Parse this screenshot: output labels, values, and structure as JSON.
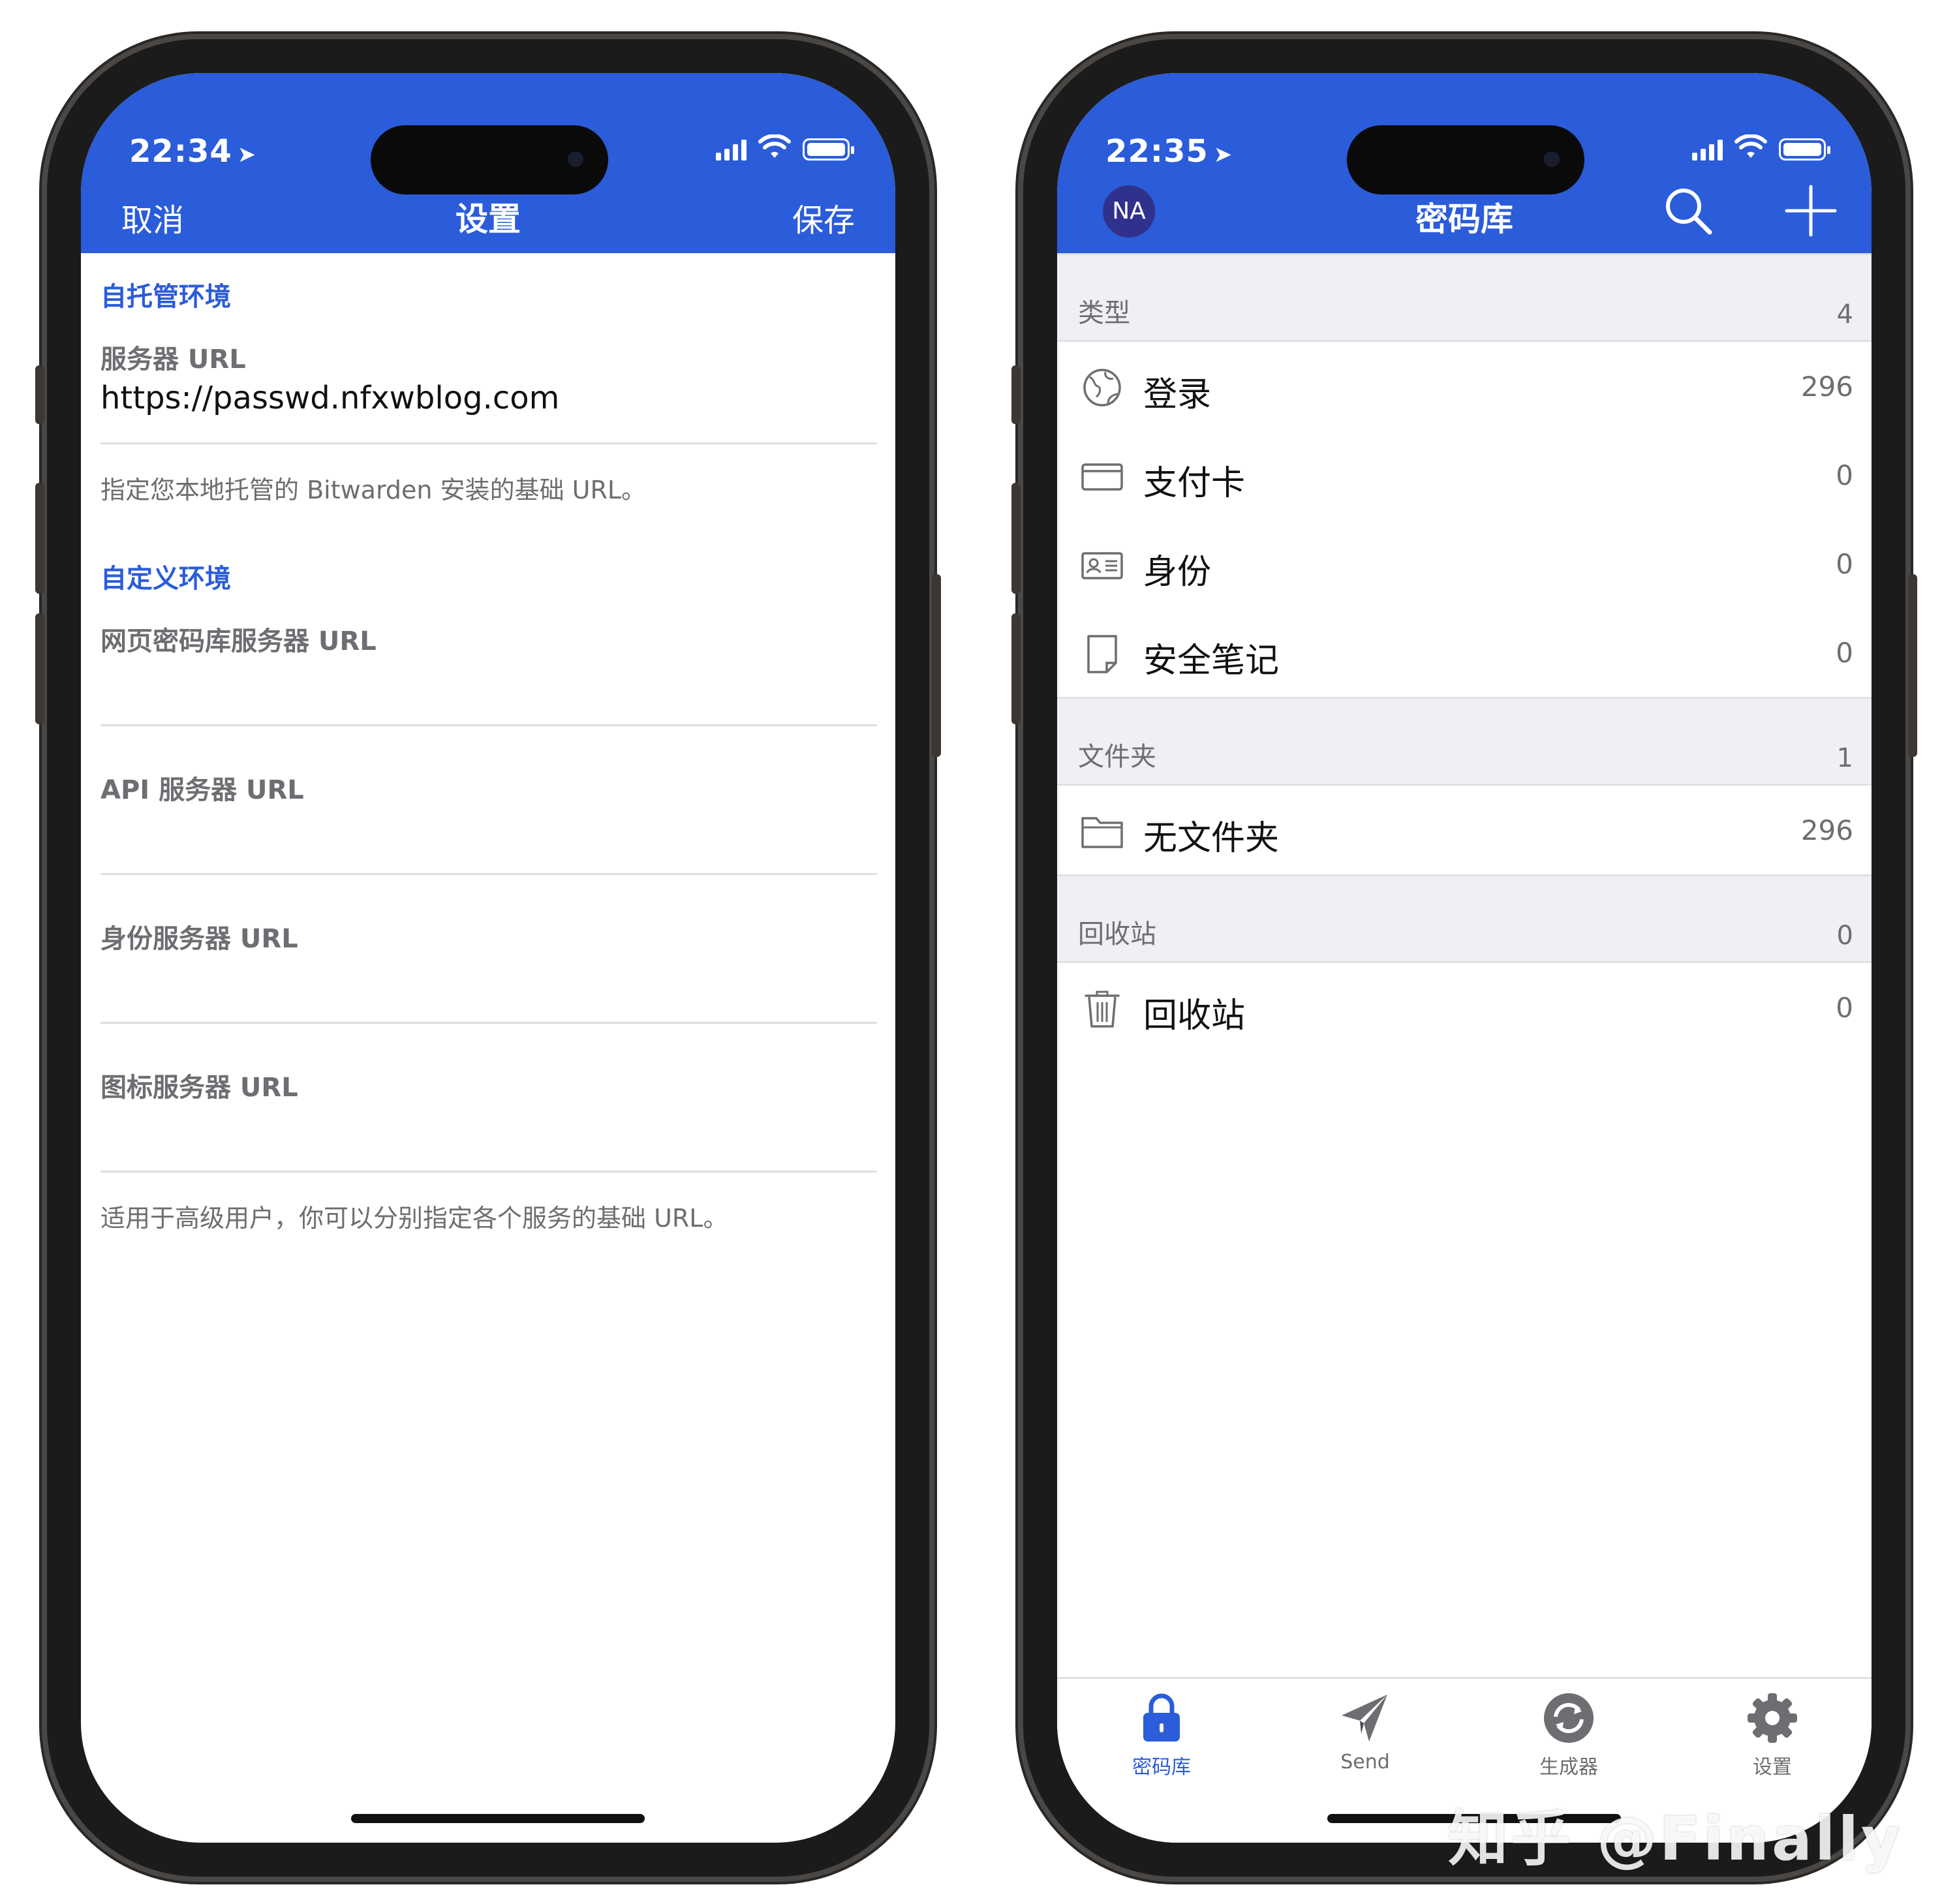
{
  "left_phone": {
    "status": {
      "time": "22:34",
      "location_arrow": "location-arrow-icon"
    },
    "nav": {
      "cancel": "取消",
      "title": "设置",
      "save": "保存"
    },
    "self_hosted": {
      "section": "自托管环境",
      "server_url_label": "服务器 URL",
      "server_url_value": "https://passwd.nfxwblog.com",
      "hint": "指定您本地托管的 Bitwarden 安装的基础 URL。"
    },
    "custom": {
      "section": "自定义环境",
      "web_vault_label": "网页密码库服务器 URL",
      "api_label": "API 服务器 URL",
      "identity_label": "身份服务器 URL",
      "icons_label": "图标服务器 URL",
      "hint": "适用于高级用户，你可以分别指定各个服务的基础 URL。"
    }
  },
  "right_phone": {
    "status": {
      "time": "22:35"
    },
    "nav": {
      "avatar": "NA",
      "title": "密码库"
    },
    "types": {
      "header": "类型",
      "count": "4",
      "items": [
        {
          "label": "登录",
          "count": "296",
          "icon": "globe-icon"
        },
        {
          "label": "支付卡",
          "count": "0",
          "icon": "card-icon"
        },
        {
          "label": "身份",
          "count": "0",
          "icon": "id-card-icon"
        },
        {
          "label": "安全笔记",
          "count": "0",
          "icon": "note-icon"
        }
      ]
    },
    "folders": {
      "header": "文件夹",
      "count": "1",
      "items": [
        {
          "label": "无文件夹",
          "count": "296",
          "icon": "folder-icon"
        }
      ]
    },
    "trash": {
      "header": "回收站",
      "count": "0",
      "items": [
        {
          "label": "回收站",
          "count": "0",
          "icon": "trash-icon"
        }
      ]
    },
    "tabs": [
      {
        "label": "密码库",
        "icon": "lock-icon",
        "active": true
      },
      {
        "label": "Send",
        "icon": "paper-plane-icon",
        "active": false
      },
      {
        "label": "生成器",
        "icon": "refresh-icon",
        "active": false
      },
      {
        "label": "设置",
        "icon": "gear-icon",
        "active": false
      }
    ]
  },
  "watermark": "知乎 @Finally",
  "colors": {
    "brand_blue": "#2b5cd9",
    "section_bg": "#efeff4",
    "avatar": "#30318c"
  }
}
